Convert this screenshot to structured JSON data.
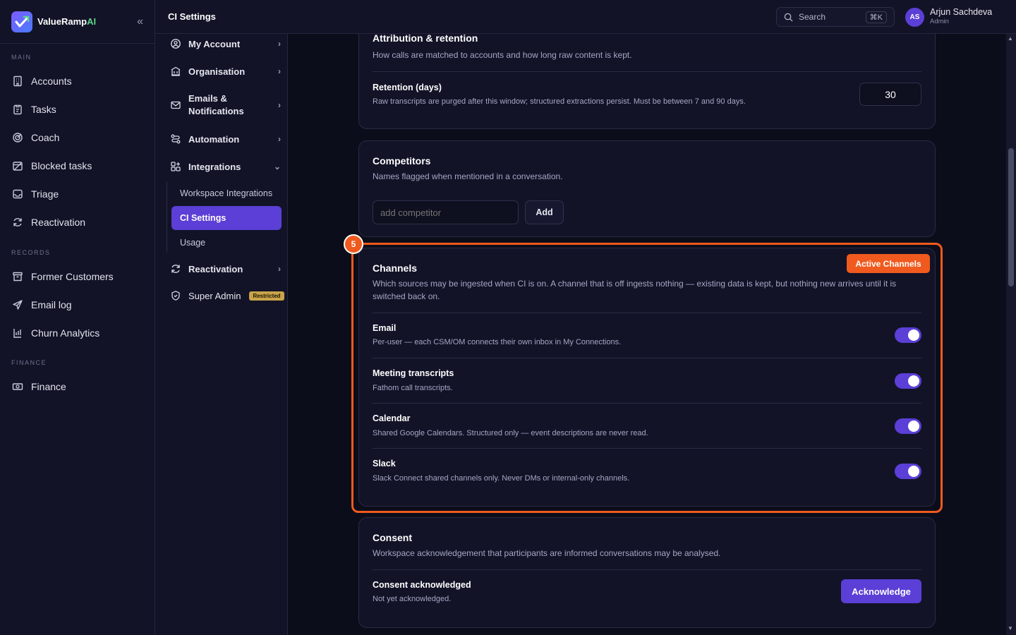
{
  "brand": {
    "name": "ValueRamp",
    "suffix": "AI"
  },
  "sidebar": {
    "sections": [
      {
        "label": "MAIN",
        "items": [
          "Accounts",
          "Tasks",
          "Coach",
          "Blocked tasks",
          "Triage",
          "Reactivation"
        ]
      },
      {
        "label": "RECORDS",
        "items": [
          "Former Customers",
          "Email log",
          "Churn Analytics"
        ]
      },
      {
        "label": "FINANCE",
        "items": [
          "Finance"
        ]
      }
    ]
  },
  "header": {
    "breadcrumb": "CI Settings",
    "search_label": "Search",
    "search_shortcut": "⌘K",
    "user": {
      "initials": "AS",
      "name": "Arjun Sachdeva",
      "role": "Admin"
    }
  },
  "subnav": {
    "items": [
      "My Account",
      "Organisation",
      "Emails &",
      "Notifications",
      "Automation",
      "Integrations",
      "Reactivation",
      "Super Admin"
    ],
    "restricted_badge": "Restricted",
    "children": [
      "Workspace Integrations",
      "CI Settings",
      "Usage"
    ]
  },
  "attribution": {
    "title": "Attribution & retention",
    "description": "How calls are matched to accounts and how long raw content is kept.",
    "retention_label": "Retention (days)",
    "retention_desc": "Raw transcripts are purged after this window; structured extractions persist. Must be between 7 and 90 days.",
    "retention_value": "30"
  },
  "competitors": {
    "title": "Competitors",
    "description": "Names flagged when mentioned in a conversation.",
    "placeholder": "add competitor",
    "add_label": "Add"
  },
  "channels": {
    "step": "5",
    "tag": "Active Channels",
    "title": "Channels",
    "description_1": "Which sources may be ingested when CI is on. A channel that is off ingests nothing — existing data is kept, but nothing new arrives until it is",
    "description_2": "switched back on.",
    "rows": [
      {
        "title": "Email",
        "desc": "Per-user — each CSM/OM connects their own inbox in My Connections.",
        "enabled": true
      },
      {
        "title": "Meeting transcripts",
        "desc": "Fathom call transcripts.",
        "enabled": true
      },
      {
        "title": "Calendar",
        "desc": "Shared Google Calendars. Structured only — event descriptions are never read.",
        "enabled": true
      },
      {
        "title": "Slack",
        "desc": "Slack Connect shared channels only. Never DMs or internal-only channels.",
        "enabled": true
      }
    ]
  },
  "consent": {
    "title": "Consent",
    "description": "Workspace acknowledgement that participants are informed conversations may be analysed.",
    "row_title": "Consent acknowledged",
    "row_desc": "Not yet acknowledged.",
    "button": "Acknowledge"
  },
  "colors": {
    "accent": "#5b3fd6",
    "highlight": "#f05a1e",
    "background": "#0c0d1a"
  }
}
